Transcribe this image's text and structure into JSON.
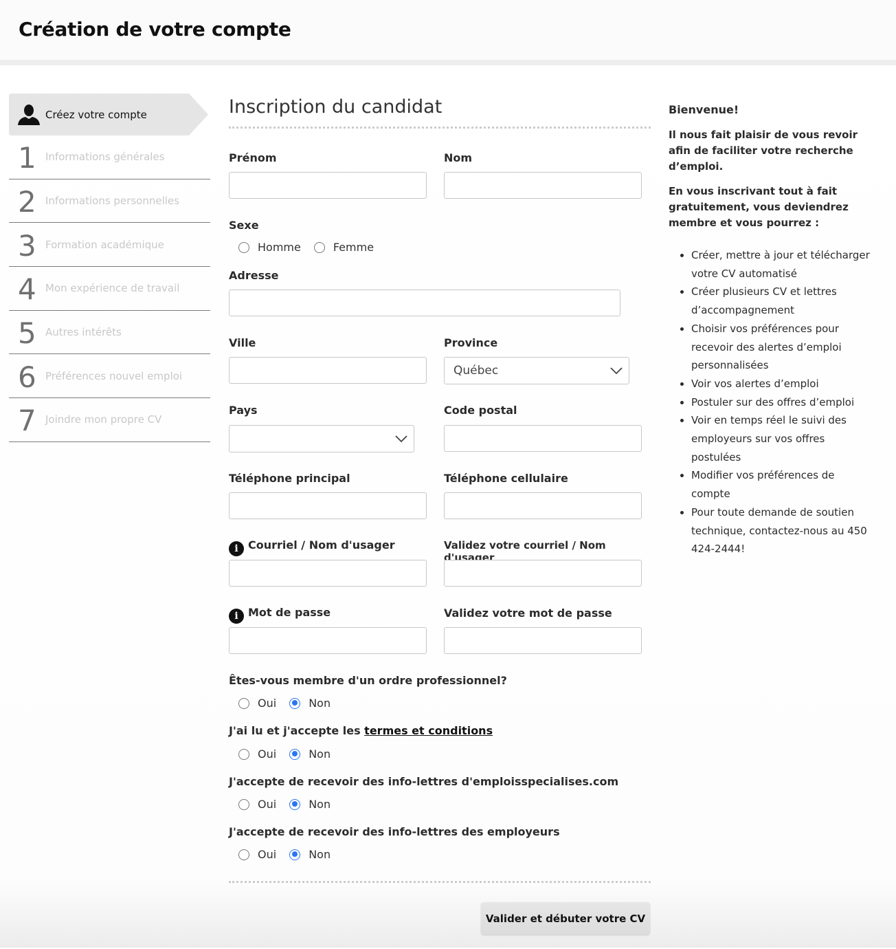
{
  "header": {
    "title": "Création de votre compte"
  },
  "sidebar": {
    "active_step": {
      "label": "Créez votre compte",
      "icon": "user-icon"
    },
    "steps": [
      {
        "num": "1",
        "label": "Informations générales"
      },
      {
        "num": "2",
        "label": "Informations personnelles"
      },
      {
        "num": "3",
        "label": "Formation académique"
      },
      {
        "num": "4",
        "label": "Mon expérience de travail"
      },
      {
        "num": "5",
        "label": "Autres intérêts"
      },
      {
        "num": "6",
        "label": "Préférences nouvel emploi"
      },
      {
        "num": "7",
        "label": "Joindre mon propre CV"
      }
    ]
  },
  "form": {
    "title": "Inscription du candidat",
    "fields": {
      "prenom": {
        "label": "Prénom",
        "value": ""
      },
      "nom": {
        "label": "Nom",
        "value": ""
      },
      "sexe": {
        "label": "Sexe",
        "options": [
          "Homme",
          "Femme"
        ],
        "selected": null
      },
      "adresse": {
        "label": "Adresse",
        "value": ""
      },
      "ville": {
        "label": "Ville",
        "value": ""
      },
      "province": {
        "label": "Province",
        "value": "Québec"
      },
      "pays": {
        "label": "Pays",
        "value": ""
      },
      "code_postal": {
        "label": "Code postal",
        "value": ""
      },
      "tel_principal": {
        "label": "Téléphone principal",
        "value": ""
      },
      "tel_cellulaire": {
        "label": "Téléphone cellulaire",
        "value": ""
      },
      "courriel": {
        "label": "Courriel / Nom d'usager",
        "value": ""
      },
      "courriel_confirm": {
        "label": "Validez votre courriel / Nom d'usager",
        "value": ""
      },
      "mot_de_passe": {
        "label": "Mot de passe",
        "value": ""
      },
      "mot_de_passe_confirm": {
        "label": "Validez votre mot de passe",
        "value": ""
      }
    },
    "questions": [
      {
        "label": "Êtes-vous membre d'un ordre professionnel?",
        "yes": "Oui",
        "no": "Non",
        "selected": "Non"
      },
      {
        "label_prefix": "J'ai lu et j'accepte les ",
        "link": "termes et conditions",
        "yes": "Oui",
        "no": "Non",
        "selected": "Non"
      },
      {
        "label": "J'accepte de recevoir des info-lettres d'emploisspecialises.com",
        "yes": "Oui",
        "no": "Non",
        "selected": "Non"
      },
      {
        "label": "J'accepte de recevoir des info-lettres des employeurs",
        "yes": "Oui",
        "no": "Non",
        "selected": "Non"
      }
    ],
    "submit_label": "Valider et débuter votre CV"
  },
  "aside": {
    "title": "Bienvenue!",
    "intro": "Il nous fait plaisir de vous revoir afin de faciliter votre recherche d’emploi.",
    "lead": "En vous inscrivant tout à fait gratuitement, vous deviendrez membre et vous pourrez :",
    "benefits": [
      "Créer, mettre à jour et télécharger votre CV automatisé",
      "Créer plusieurs CV et lettres d’accompagnement",
      "Choisir vos préférences pour recevoir des alertes d’emploi personnalisées",
      "Voir vos alertes d’emploi",
      "Postuler sur des offres d’emploi",
      "Voir en temps réel le suivi des employeurs sur vos offres postulées",
      "Modifier vos préférences de compte",
      "Pour toute demande de soutien technique, contactez-nous au 450 424-2444!"
    ]
  },
  "colors": {
    "radio_accent": "#2b76f0",
    "active_step_bg": "#e5e5e5",
    "button_bg": "#e1e1e1"
  }
}
